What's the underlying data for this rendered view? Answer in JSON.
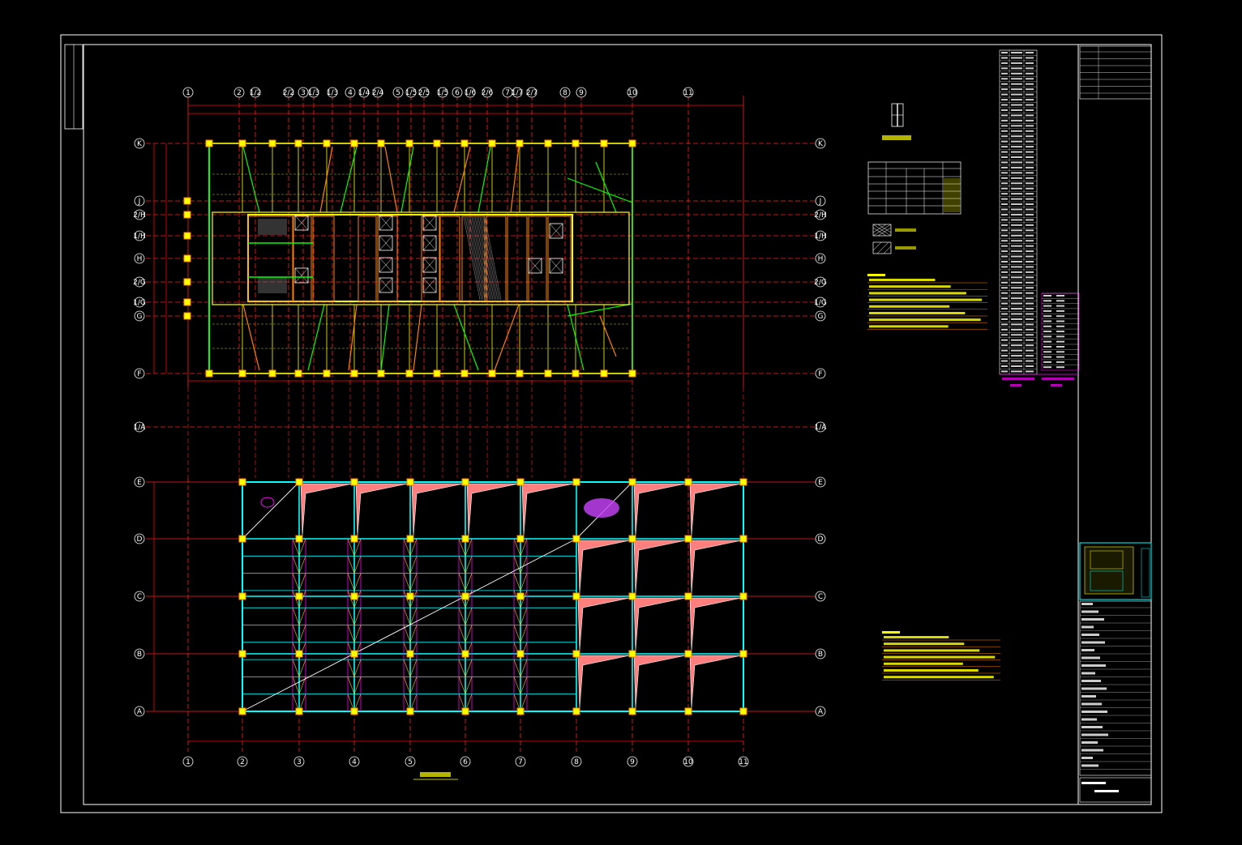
{
  "drawing": {
    "type": "structural-floor-plan",
    "background": "#000000",
    "colors": {
      "frame": "#ffffff",
      "grid": "#ff2020",
      "beam_primary": "#ffff00",
      "beam_secondary": "#00ff00",
      "slab_lines": "#00ffff",
      "bracing": "#ff00ff",
      "diagonal": "#ff8000",
      "slab_fill": "#ff7f7f",
      "dimension": "#ff0000",
      "core": "#ffff00"
    }
  },
  "upper_plan": {
    "columns": [
      "1",
      "2",
      "1/2",
      "2/2",
      "3",
      "1/3",
      "1/3",
      "4",
      "1/4",
      "2/4",
      "5",
      "1/5",
      "2/5",
      "1/5",
      "6",
      "1/6",
      "2/6",
      "7",
      "1/7",
      "2/7",
      "8",
      "9",
      "10",
      "11"
    ],
    "rows": [
      "K",
      "J",
      "2/H",
      "1/H",
      "H",
      "2/G",
      "1/G",
      "G",
      "F"
    ]
  },
  "lower_plan": {
    "columns": [
      "1",
      "2",
      "3",
      "4",
      "5",
      "6",
      "7",
      "8",
      "9",
      "10",
      "11"
    ],
    "rows": [
      "E",
      "D",
      "C",
      "B",
      "A"
    ],
    "middle_row": "1/A"
  },
  "tables": {
    "beam_table_rows": 6,
    "legend_items": [
      "hatched-cross",
      "hatched-diagonal"
    ],
    "notes_count": 8,
    "elevation_table_rows": 62
  },
  "title_block": {
    "has_key_plan": true
  },
  "icons": {
    "axis_bubble": "circle-icon",
    "column": "square-icon"
  }
}
